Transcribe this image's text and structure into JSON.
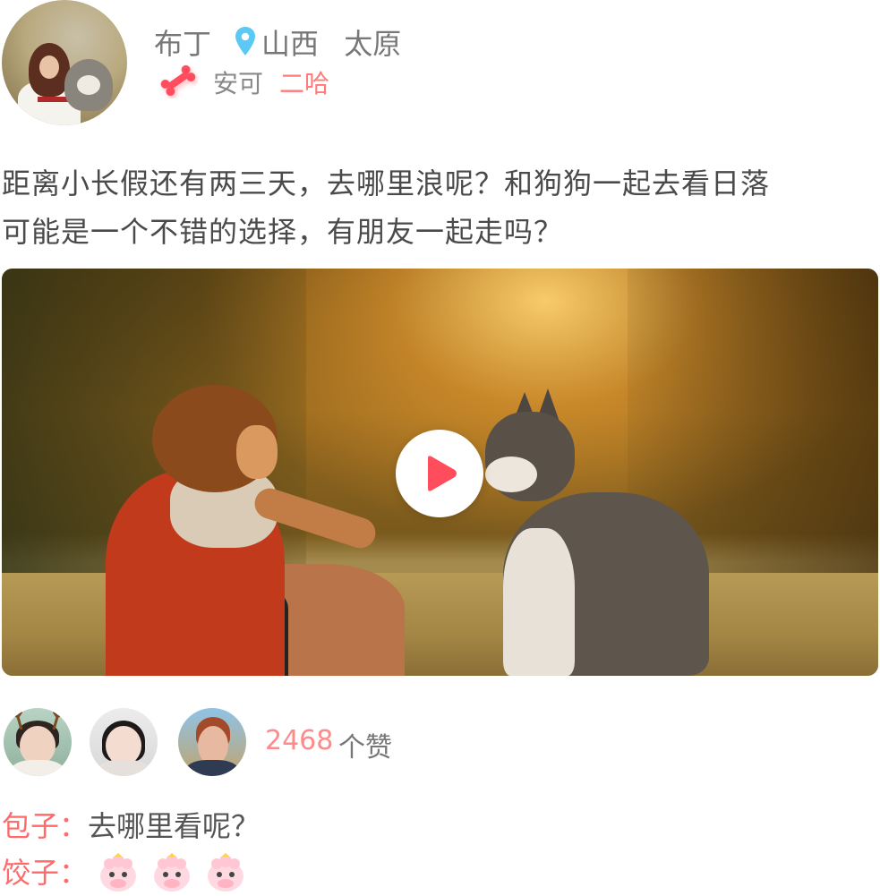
{
  "post": {
    "user": {
      "name": "布丁",
      "province": "山西",
      "city": "太原"
    },
    "pet": {
      "label": "安可",
      "name": "二哈"
    },
    "text_line1": "距离小长假还有两三天，去哪里浪呢？和狗狗一起去看日落",
    "text_line2": "可能是一个不错的选择，有朋友一起走吗？",
    "likes": {
      "count": "2468",
      "unit": "个赞"
    },
    "comments": [
      {
        "author": "包子",
        "sep": "：",
        "text": "去哪里看呢？"
      },
      {
        "author": "饺子",
        "sep": "：",
        "stickers": [
          "sheep-sticker",
          "sheep-sticker",
          "sheep-sticker"
        ]
      }
    ]
  },
  "colors": {
    "accent": "#ff6a6a",
    "location_icon": "#5cc9f5",
    "bone_icon": "#ff4d5e",
    "play_icon": "#ff4d5e"
  }
}
